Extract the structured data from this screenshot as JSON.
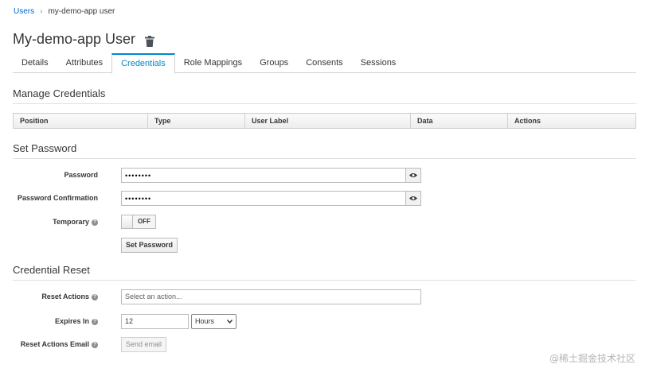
{
  "breadcrumb": {
    "parent": "Users",
    "separator": "›",
    "current": "my-demo-app user"
  },
  "page": {
    "title": "My-demo-app User"
  },
  "tabs": [
    {
      "label": "Details"
    },
    {
      "label": "Attributes"
    },
    {
      "label": "Credentials",
      "active": true
    },
    {
      "label": "Role Mappings"
    },
    {
      "label": "Groups"
    },
    {
      "label": "Consents"
    },
    {
      "label": "Sessions"
    }
  ],
  "manage": {
    "title": "Manage Credentials",
    "columns": [
      "Position",
      "Type",
      "User Label",
      "Data",
      "Actions"
    ]
  },
  "set_password": {
    "title": "Set Password",
    "password_label": "Password",
    "password_value": "••••••••",
    "confirm_label": "Password Confirmation",
    "confirm_value": "••••••••",
    "temporary_label": "Temporary",
    "temporary_state": "OFF",
    "button": "Set Password"
  },
  "reset": {
    "title": "Credential Reset",
    "actions_label": "Reset Actions",
    "actions_placeholder": "Select an action...",
    "expires_label": "Expires In",
    "expires_value": "12",
    "expires_unit": "Hours",
    "email_label": "Reset Actions Email",
    "email_button": "Send email"
  },
  "watermark": "@稀土掘金技术社区",
  "colors": {
    "link": "#0066cc",
    "active_tab": "#0088ce"
  }
}
